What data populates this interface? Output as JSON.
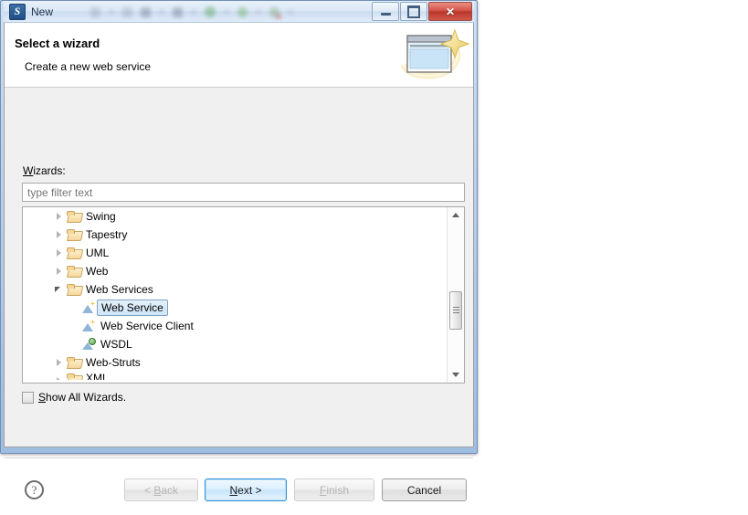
{
  "window": {
    "title": "New",
    "app_icon": "eclipse-icon",
    "controls": {
      "minimize": "minimize-button",
      "maximize": "restore-button",
      "close_label": "✕"
    }
  },
  "banner": {
    "title": "Select a wizard",
    "subtitle": "Create a new web service",
    "icon": "wizard-banner-icon"
  },
  "content": {
    "wizards_label": "Wizards:",
    "wizards_label_mnemonic": "W",
    "filter_placeholder": "type filter text",
    "filter_value": "",
    "show_all_label": "Show All Wizards.",
    "show_all_mnemonic": "S",
    "show_all_checked": false
  },
  "tree": {
    "items": [
      {
        "label": "Swing",
        "icon": "folder-icon",
        "indent": 1,
        "state": "collapsed",
        "selected": false
      },
      {
        "label": "Tapestry",
        "icon": "folder-icon",
        "indent": 1,
        "state": "collapsed",
        "selected": false
      },
      {
        "label": "UML",
        "icon": "folder-icon",
        "indent": 1,
        "state": "collapsed",
        "selected": false
      },
      {
        "label": "Web",
        "icon": "folder-icon",
        "indent": 1,
        "state": "collapsed",
        "selected": false
      },
      {
        "label": "Web Services",
        "icon": "folder-icon",
        "indent": 1,
        "state": "expanded",
        "selected": false
      },
      {
        "label": "Web Service",
        "icon": "wizard-icon",
        "indent": 2,
        "state": "leaf",
        "selected": true
      },
      {
        "label": "Web Service Client",
        "icon": "wizard-icon",
        "indent": 2,
        "state": "leaf",
        "selected": false
      },
      {
        "label": "WSDL",
        "icon": "wsdl-icon",
        "indent": 2,
        "state": "leaf",
        "selected": false
      },
      {
        "label": "Web-Struts",
        "icon": "folder-icon",
        "indent": 1,
        "state": "collapsed",
        "selected": false
      },
      {
        "label": "XML",
        "icon": "folder-icon",
        "indent": 1,
        "state": "collapsed",
        "selected": false
      }
    ],
    "scrollbar": {
      "thumb_position_pct": 65
    }
  },
  "buttons": {
    "help": "?",
    "back": {
      "label": "< Back",
      "mnemonic": "B",
      "enabled": false,
      "default": false
    },
    "next": {
      "label": "Next >",
      "mnemonic": "N",
      "enabled": true,
      "default": true
    },
    "finish": {
      "label": "Finish",
      "mnemonic": "F",
      "enabled": false,
      "default": false
    },
    "cancel": {
      "label": "Cancel",
      "mnemonic": "",
      "enabled": true,
      "default": false
    }
  },
  "colors": {
    "dialog_bg": "#f0f0f0",
    "banner_bg": "#ffffff",
    "frame_blue": "#9fbde0",
    "selection_blue": "#cfe5f8",
    "default_button_border": "#2a8ed6",
    "close_button_red": "#b93629",
    "folder_yellow": "#f6d79a",
    "page_bg": "#ffffff"
  }
}
